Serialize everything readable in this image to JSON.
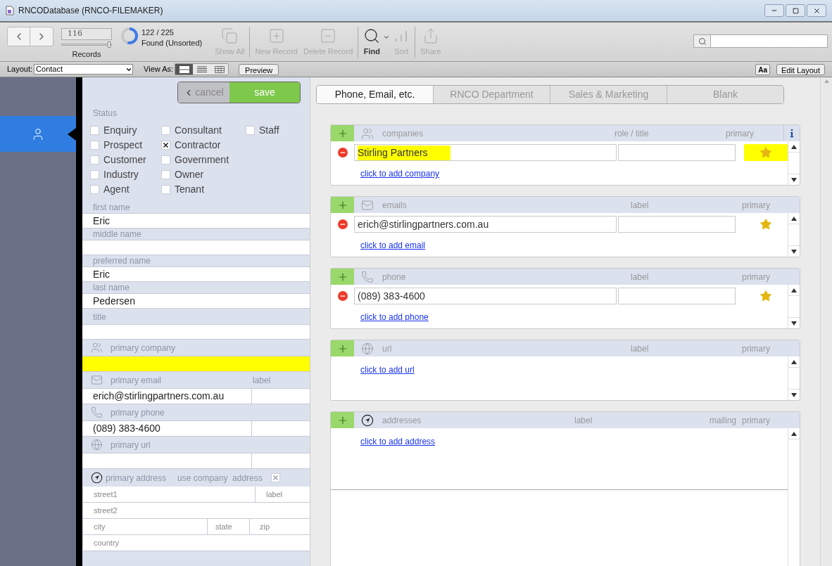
{
  "window": {
    "title": "RNCODatabase (RNCO-FILEMAKER)"
  },
  "toolbar": {
    "record_number": "116",
    "records_label": "Records",
    "found_count": "122 / 225",
    "found_status": "Found (Unsorted)",
    "level": 0.54,
    "record_slider": {
      "level": 0.95
    },
    "buttons": [
      {
        "kind": "show_all",
        "label": "Show All",
        "disabled": true
      },
      {
        "kind": "new",
        "label": "New Record",
        "disabled": true
      },
      {
        "kind": "delete",
        "label": "Delete Record",
        "disabled": true
      },
      {
        "kind": "find",
        "label": "Find",
        "disabled": false
      },
      {
        "kind": "sort",
        "label": "Sort",
        "disabled": true
      },
      {
        "kind": "share",
        "label": "Share",
        "disabled": true
      }
    ]
  },
  "layout_bar": {
    "layout_label": "Layout:",
    "layout_value": "Contact",
    "view_as_label": "View As:",
    "view_modes": [
      {
        "kind": "form",
        "selected": true
      },
      {
        "kind": "list",
        "selected": false
      },
      {
        "kind": "table",
        "selected": false
      }
    ],
    "preview_button": "Preview",
    "format_button": "Aa",
    "edit_layout_button": "Edit Layout"
  },
  "sidebar": {
    "items": [
      {
        "kind": "contact",
        "selected": true
      }
    ]
  },
  "form": {
    "cancel_button": "cancel",
    "save_button": "save",
    "status_label": "Status",
    "status_columns": [
      [
        {
          "label": "Enquiry",
          "checked": false
        },
        {
          "label": "Prospect",
          "checked": false
        },
        {
          "label": "Customer",
          "checked": false
        },
        {
          "label": "Industry",
          "checked": false
        },
        {
          "label": "Agent",
          "checked": false
        }
      ],
      [
        {
          "label": "Consultant",
          "checked": false
        },
        {
          "label": "Contractor",
          "checked": true
        },
        {
          "label": "Government",
          "checked": false
        },
        {
          "label": "Owner",
          "checked": false
        },
        {
          "label": "Tenant",
          "checked": false
        }
      ],
      [
        {
          "label": "Staff",
          "checked": false
        }
      ]
    ],
    "name_fields": [
      {
        "label": "first name",
        "value": "Eric"
      },
      {
        "label": "middle name"
      },
      {
        "label": "preferred name",
        "value": "Eric"
      },
      {
        "label": "last name",
        "value": "Pedersen"
      },
      {
        "label": "title"
      }
    ],
    "primary_fields": [
      {
        "kind": "company",
        "label": "primary company",
        "highlighted": true
      },
      {
        "kind": "email",
        "label": "primary email",
        "column_label": "label",
        "value": "erich@stirlingpartners.com.au",
        "highlighted": false
      },
      {
        "kind": "phone",
        "label": "primary phone",
        "value": "(089) 383-4600",
        "highlighted": false
      },
      {
        "kind": "url",
        "label": "primary url",
        "highlighted": false
      }
    ],
    "address": {
      "label": "primary address",
      "use_company_label": "use company  address",
      "use_company_checked": true,
      "rows": [
        [
          {
            "placeholder": "street1"
          },
          {
            "placeholder": "label"
          }
        ],
        [
          {
            "placeholder": "street2"
          }
        ],
        [
          {
            "placeholder": "city"
          },
          {
            "placeholder": "state"
          },
          {
            "placeholder": "zip"
          }
        ],
        [
          {
            "placeholder": "country"
          }
        ]
      ]
    }
  },
  "tabs": [
    {
      "label": "Phone, Email, etc.",
      "selected": true
    },
    {
      "label": "RNCO Department",
      "selected": false
    },
    {
      "label": "Sales & Marketing",
      "selected": false
    },
    {
      "label": "Blank",
      "selected": false
    }
  ],
  "portals": [
    {
      "kind": "company",
      "title": "companies",
      "columns": [
        "role / title",
        "primary"
      ],
      "info_button": true,
      "rows": [
        {
          "value": "Stirling Partners",
          "primary": true,
          "highlighted": true
        }
      ],
      "add_link": "click to add company"
    },
    {
      "kind": "email",
      "title": "emails",
      "columns": [
        "label",
        "primary"
      ],
      "info_button": false,
      "rows": [
        {
          "value": "erich@stirlingpartners.com.au",
          "primary": true,
          "highlighted": false
        }
      ],
      "add_link": "click to add email"
    },
    {
      "kind": "phone",
      "title": "phone",
      "columns": [
        "label",
        "primary"
      ],
      "info_button": false,
      "rows": [
        {
          "value": "(089) 383-4600",
          "primary": true,
          "highlighted": false
        }
      ],
      "add_link": "click to add phone"
    },
    {
      "kind": "url",
      "title": "url",
      "columns": [
        "label",
        "primary"
      ],
      "info_button": false,
      "add_link": "click to add url"
    },
    {
      "kind": "address",
      "title": "addresses",
      "columns": [
        "label",
        "mailing",
        "primary"
      ],
      "info_button": false,
      "add_link": "click to add address"
    }
  ]
}
